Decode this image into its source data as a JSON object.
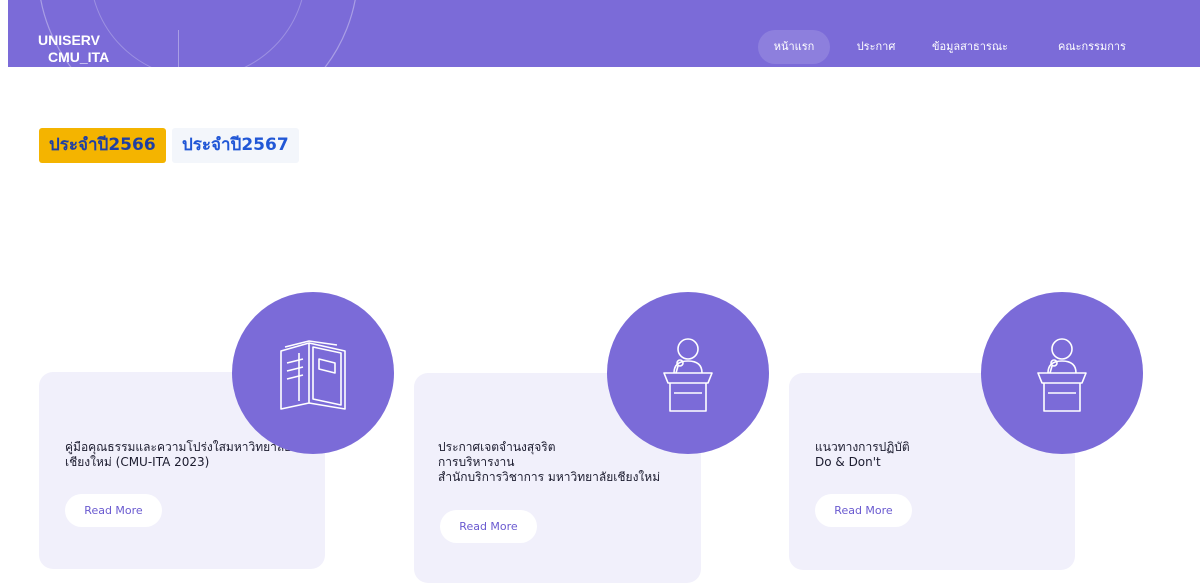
{
  "header": {
    "logo_line1": "UNISERV",
    "logo_line2": "CMU_ITA",
    "nav": [
      {
        "label": "หน้าแรก",
        "active": true
      },
      {
        "label": "ประกาศ",
        "active": false
      },
      {
        "label": "ข้อมูลสาธารณะ",
        "active": false
      },
      {
        "label": "คณะกรรมการ",
        "active": false
      }
    ]
  },
  "year_tabs": [
    {
      "label": "ประจำปี2566",
      "active": true
    },
    {
      "label": "ประจำปี2567",
      "active": false
    }
  ],
  "cards": [
    {
      "title_lines": [
        "คู่มือคุณธรรมและความโปร่งใสมหาวิทยาลัย",
        "เชียงใหม่ (CMU-ITA 2023)"
      ],
      "button": "Read More",
      "icon": "book-icon"
    },
    {
      "title_lines": [
        "ประกาศเจตจำนงสุจริต",
        "การบริหารงาน",
        "สำนักบริการวิชาการ มหาวิทยาลัยเชียงใหม่"
      ],
      "button": "Read More",
      "icon": "speaker-podium-icon"
    },
    {
      "title_lines": [
        "แนวทางการปฏิบัติ",
        "Do & Don't"
      ],
      "button": "Read More",
      "icon": "speaker-podium-icon"
    }
  ],
  "colors": {
    "header": "#7b6bd8",
    "accent_yellow": "#f4b400",
    "card_bg": "#f1f0fb",
    "link_blue": "#2157d6"
  }
}
